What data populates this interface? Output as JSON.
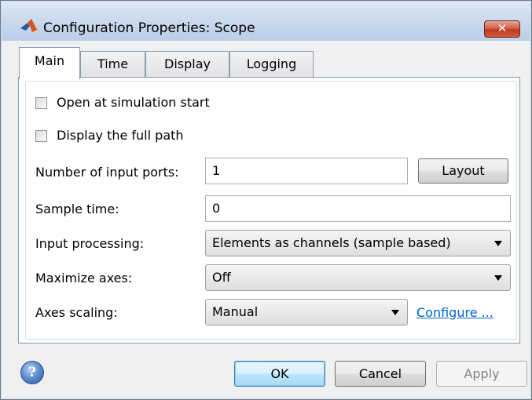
{
  "window": {
    "title": "Configuration Properties: Scope",
    "close_label": "✕",
    "icon": "matlab-icon"
  },
  "tabs": [
    {
      "label": "Main",
      "active": true
    },
    {
      "label": "Time",
      "active": false
    },
    {
      "label": "Display",
      "active": false
    },
    {
      "label": "Logging",
      "active": false
    }
  ],
  "main": {
    "open_at_start": {
      "label": "Open at simulation start",
      "checked": false
    },
    "display_full_path": {
      "label": "Display the full path",
      "checked": false
    },
    "input_ports": {
      "label": "Number of input ports:",
      "value": "1",
      "button_label": "Layout"
    },
    "sample_time": {
      "label": "Sample time:",
      "value": "0"
    },
    "input_processing": {
      "label": "Input processing:",
      "selected": "Elements as channels (sample based)"
    },
    "maximize_axes": {
      "label": "Maximize axes:",
      "selected": "Off"
    },
    "axes_scaling": {
      "label": "Axes scaling:",
      "selected": "Manual",
      "link_label": "Configure ..."
    }
  },
  "footer": {
    "help_icon": "help-icon",
    "help_glyph": "?",
    "ok_label": "OK",
    "cancel_label": "Cancel",
    "apply_label": "Apply"
  }
}
